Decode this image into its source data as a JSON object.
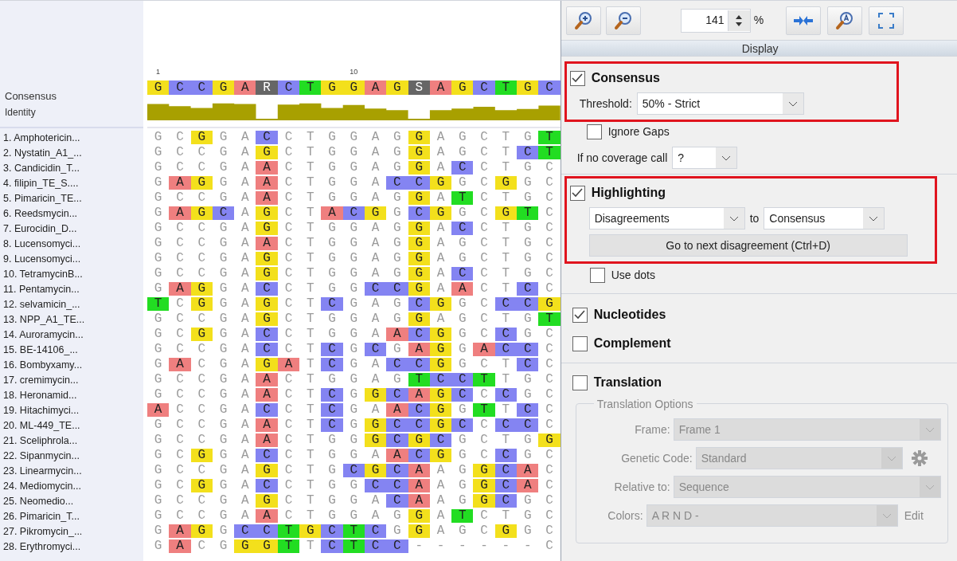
{
  "alignment": {
    "ruler": [
      "1",
      "10"
    ],
    "consensus_label": "Consensus",
    "identity_label": "Identity",
    "consensus": "G C C G A R C T G G A G S A G C T G C",
    "sequences": [
      {
        "name": "1. Amphotericin...",
        "bases": "G C G G A C C T G G A G G A G C T G T"
      },
      {
        "name": "2. Nystatin_A1_...",
        "bases": "G C C G A G C T G G A G G A G C T C T"
      },
      {
        "name": "3. Candicidin_T...",
        "bases": "G C C G A A C T G G A G G A C C T G C"
      },
      {
        "name": "4. filipin_TE_S....",
        "bases": "G A G G A A C T G G A C C G G C G G C"
      },
      {
        "name": "5. Pimaricin_TE...",
        "bases": "G C C G A A C T G G A G G A T C T G C"
      },
      {
        "name": "6. Reedsmycin...",
        "bases": "G A G C A G C T A C G G C G G C G T C"
      },
      {
        "name": "7. Eurocidin_D...",
        "bases": "G C C G A G C T G G A G G A C C T G C"
      },
      {
        "name": "8. Lucensomyci...",
        "bases": "G C C G A A C T G G A G G A G C T G C"
      },
      {
        "name": "9. Lucensomyci...",
        "bases": "G C C G A G C T G G A G G A G C T G C"
      },
      {
        "name": "10. TetramycinB...",
        "bases": "G C C G A G C T G G A G G A C C T G C"
      },
      {
        "name": "11. Pentamycin...",
        "bases": "G A G G A C C T G G C C G A A C T C C"
      },
      {
        "name": "12. selvamicin_...",
        "bases": "T C G G A G C T C G A G C G G C C C G"
      },
      {
        "name": "13. NPP_A1_TE...",
        "bases": "G C C G A G C T G G A G G A G C T G T"
      },
      {
        "name": "14. Auroramycin...",
        "bases": "G C G G A C C T G G A A C G G C C G C"
      },
      {
        "name": "15. BE-14106_...",
        "bases": "G C C G A C C T C G C G A G G A C C C"
      },
      {
        "name": "16. Bombyxamy...",
        "bases": "G A C G A G A T C G A C C G G C T C C"
      },
      {
        "name": "17. cremimycin...",
        "bases": "G C C G A A C T G G A G T C C T T G C"
      },
      {
        "name": "18. Heronamid...",
        "bases": "G C C G A A C T C G G C A G C C C G C"
      },
      {
        "name": "19. Hitachimyci...",
        "bases": "A C C G A C C T C G A A C G G T T C C"
      },
      {
        "name": "20. ML-449_TE...",
        "bases": "G C C G A A C T C G G C C G C C C C C"
      },
      {
        "name": "21. Sceliphrola...",
        "bases": "G C C G A A C T G G G C G C G C T G G"
      },
      {
        "name": "22. Sipanmycin...",
        "bases": "G C G G A C C T G G A A C G G C C G C"
      },
      {
        "name": "23. Linearmycin...",
        "bases": "G C C G A G C T G C G C A A G G C A C"
      },
      {
        "name": "24. Mediomycin...",
        "bases": "G C G G A C C T G G C C A A G G C A C"
      },
      {
        "name": "25. Neomedio...",
        "bases": "G C C G A G C T G G A C A A G G C G C"
      },
      {
        "name": "26. Pimaricin_T...",
        "bases": "G C C G A A C T G G A G G A T C T G C"
      },
      {
        "name": "27. Pikromycin_...",
        "bases": "G A G G C C T G C T C G G A G C G G C"
      },
      {
        "name": "28. Erythromyci...",
        "bases": "G A C G G G T T C T C C - - - - - - C"
      }
    ]
  },
  "toolbar": {
    "zoom": "141",
    "unit": "%"
  },
  "display": {
    "title": "Display",
    "consensus": {
      "label": "Consensus",
      "checked": true,
      "outlined": true,
      "threshold_label": "Threshold:",
      "threshold": "50% - Strict",
      "ignore_gaps": {
        "label": "Ignore Gaps",
        "checked": false
      },
      "no_coverage_label": "If no coverage call",
      "no_coverage": "?"
    },
    "highlighting": {
      "label": "Highlighting",
      "checked": true,
      "outlined": true,
      "mode": "Disagreements",
      "to_label": "to",
      "reference": "Consensus",
      "next_button": "Go to next disagreement (Ctrl+D)",
      "use_dots": {
        "label": "Use dots",
        "checked": false
      }
    },
    "nucleotides": {
      "label": "Nucleotides",
      "checked": true
    },
    "complement": {
      "label": "Complement",
      "checked": false
    },
    "translation": {
      "label": "Translation",
      "checked": false,
      "options_title": "Translation Options",
      "fields": [
        {
          "label": "Frame:",
          "value": "Frame 1"
        },
        {
          "label": "Genetic Code:",
          "value": "Standard",
          "kind": "gear"
        },
        {
          "label": "Relative to:",
          "value": "Sequence"
        },
        {
          "label": "Colors:",
          "value": "A R N D -",
          "kind": "edit",
          "button": "Edit"
        }
      ]
    }
  }
}
